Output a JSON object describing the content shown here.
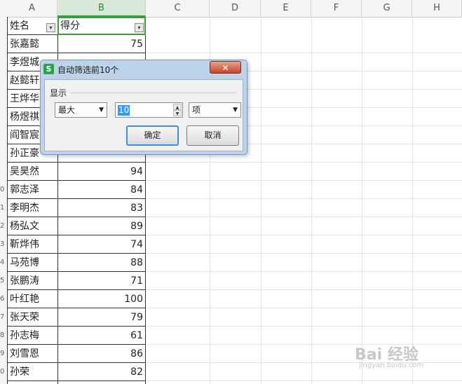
{
  "columns": [
    "A",
    "B",
    "C",
    "D",
    "E",
    "F",
    "G",
    "H"
  ],
  "header": {
    "name_label": "姓名",
    "score_label": "得分",
    "filter_glyph": "▾"
  },
  "rows": [
    {
      "name": "张嘉懿",
      "score": "75"
    },
    {
      "name": "李煜城",
      "score": ""
    },
    {
      "name": "赵懿轩",
      "score": ""
    },
    {
      "name": "王烨华",
      "score": ""
    },
    {
      "name": "杨煜祺",
      "score": ""
    },
    {
      "name": "阎智宸",
      "score": ""
    },
    {
      "name": "孙正豪",
      "score": ""
    },
    {
      "name": "吴昊然",
      "score": "94"
    },
    {
      "name": "郭志泽",
      "score": "84"
    },
    {
      "name": "李明杰",
      "score": "83"
    },
    {
      "name": "杨弘文",
      "score": "89"
    },
    {
      "name": "靳烨伟",
      "score": "74"
    },
    {
      "name": "马苑博",
      "score": "88"
    },
    {
      "name": "张鹏涛",
      "score": "71"
    },
    {
      "name": "叶红艳",
      "score": "100"
    },
    {
      "name": "张天荣",
      "score": "79"
    },
    {
      "name": "孙志梅",
      "score": "61"
    },
    {
      "name": "刘雪恩",
      "score": "86"
    },
    {
      "name": "孙荣",
      "score": "82"
    }
  ],
  "row_numbers": [
    "",
    "",
    "",
    "",
    "",
    "",
    "",
    "",
    "0",
    "1",
    "2",
    "3",
    "4",
    "5",
    "6",
    "7",
    "8",
    "9",
    "0"
  ],
  "dialog": {
    "app_icon": "S",
    "title": "自动筛选前10个",
    "close_glyph": "✕",
    "group_label": "显示",
    "mode_value": "最大",
    "count_value": "10",
    "unit_value": "项",
    "ok_label": "确定",
    "cancel_label": "取消",
    "dropdown_glyph": "▼",
    "spin_up": "▲",
    "spin_down": "▼"
  },
  "watermark": {
    "text": "Bai 经验",
    "sub": "jingyan.baidu.com"
  },
  "colors": {
    "accent": "#3a9d3a",
    "dialog_frame": "#bcd3ea",
    "close": "#c8452b"
  }
}
